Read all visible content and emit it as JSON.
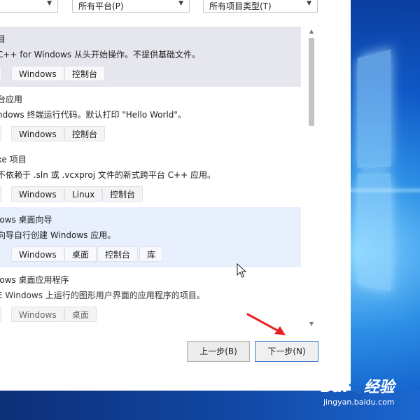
{
  "filters": {
    "language": "",
    "platform": "所有平台(P)",
    "project_type": "所有项目类型(T)"
  },
  "templates": [
    {
      "title": "目",
      "description": "C++ for Windows 从头开始操作。不提供基础文件。",
      "tags": [
        "",
        "Windows",
        "控制台"
      ],
      "state": "selected"
    },
    {
      "title": "台应用",
      "description": "ndows 终端运行代码。默认打印 \"Hello World\"。",
      "tags": [
        "",
        "Windows",
        "控制台"
      ],
      "state": "normal"
    },
    {
      "title": "ke 项目",
      "description": "不依赖于 .sln 或 .vcxproj 文件的新式跨平台 C++ 应用。",
      "tags": [
        "",
        "Windows",
        "Linux",
        "控制台"
      ],
      "state": "normal"
    },
    {
      "title": "lows 桌面向导",
      "description": "向导自行创建 Windows 应用。",
      "tags": [
        "",
        "Windows",
        "桌面",
        "控制台",
        "库"
      ],
      "state": "hover"
    },
    {
      "title": "lows 桌面应用程序",
      "description": "E Windows 上运行的图形用户界面的应用程序的项目。",
      "tags": [
        "",
        "Windows",
        "桌面"
      ],
      "state": "faded"
    }
  ],
  "buttons": {
    "back": "上一步(B)",
    "next": "下一步(N)"
  },
  "watermark": {
    "logo": "Bai",
    "logo_suffix": "经验",
    "url": "jingyan.baidu.com"
  },
  "colors": {
    "selected_row": "#e6e7ee",
    "hover_row": "#e8f0fe",
    "next_button_border": "#3a78d4",
    "annotation_arrow": "#e8201f"
  },
  "icons": {
    "dropdown": "chevron-down-icon",
    "scroll_up": "scroll-up-arrow-icon",
    "scroll_down": "scroll-down-arrow-icon",
    "cursor": "mouse-cursor-icon",
    "annotation": "red-arrow-icon"
  }
}
